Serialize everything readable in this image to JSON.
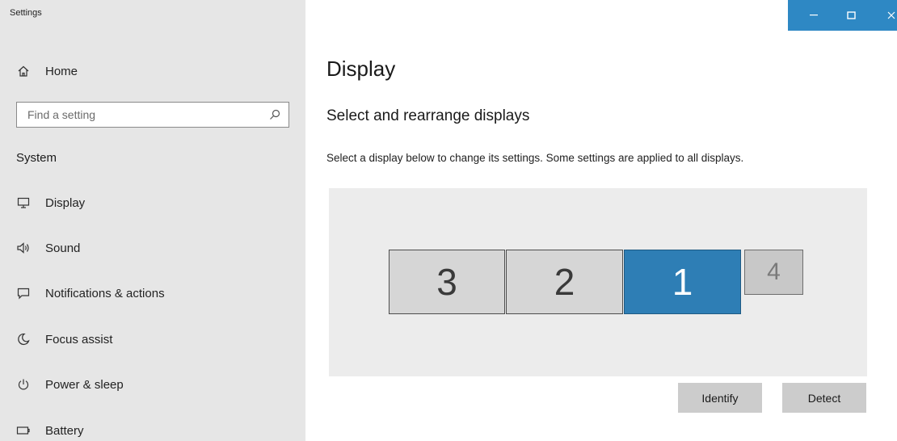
{
  "window": {
    "title": "Settings",
    "controls": {
      "minimize": "–",
      "maximize": "□",
      "close": "X"
    },
    "accent_color": "#2e88c4"
  },
  "sidebar": {
    "home_label": "Home",
    "search": {
      "placeholder": "Find a setting",
      "value": ""
    },
    "section": "System",
    "items": [
      {
        "label": "Display",
        "icon": "monitor-icon"
      },
      {
        "label": "Sound",
        "icon": "speaker-icon"
      },
      {
        "label": "Notifications & actions",
        "icon": "notification-icon"
      },
      {
        "label": "Focus assist",
        "icon": "moon-icon"
      },
      {
        "label": "Power & sleep",
        "icon": "power-icon"
      },
      {
        "label": "Battery",
        "icon": "battery-icon"
      }
    ]
  },
  "main": {
    "title": "Display",
    "subtitle": "Select and rearrange displays",
    "description": "Select a display below to change its settings. Some settings are applied to all displays.",
    "displays": [
      {
        "number": "3",
        "selected": false
      },
      {
        "number": "2",
        "selected": false
      },
      {
        "number": "1",
        "selected": true
      },
      {
        "number": "4",
        "selected": false
      }
    ],
    "selected_color": "#2e7eb5",
    "buttons": {
      "identify": "Identify",
      "detect": "Detect"
    }
  }
}
